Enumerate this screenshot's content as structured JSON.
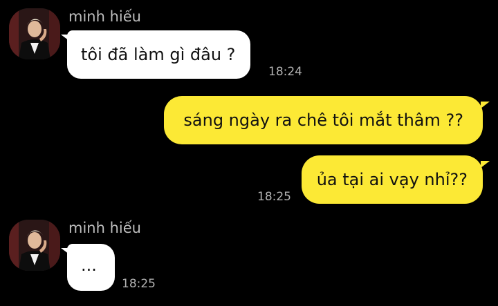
{
  "colors": {
    "background": "#000000",
    "incoming_bubble": "#ffffff",
    "outgoing_bubble": "#fce935",
    "sender_name": "#bdbdbd",
    "timestamp": "#b3b3b3"
  },
  "messages": [
    {
      "direction": "incoming",
      "sender": "minh hiếu",
      "text": "tôi đã làm gì đâu ?",
      "time": "18:24",
      "avatar": "user-avatar"
    },
    {
      "direction": "outgoing",
      "text": "sáng ngày ra chê tôi mắt thâm ??"
    },
    {
      "direction": "outgoing",
      "text": "ủa tại ai vạy nhỉ??",
      "time": "18:25"
    },
    {
      "direction": "incoming",
      "sender": "minh hiếu",
      "text": "...",
      "time": "18:25",
      "avatar": "user-avatar"
    }
  ]
}
